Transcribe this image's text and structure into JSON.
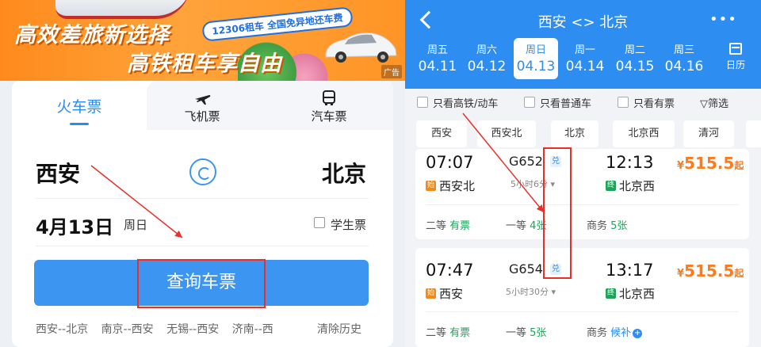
{
  "left": {
    "banner": {
      "tag": "12306租车 全国免异地还车费",
      "line1": "高效差旅新选择",
      "line2": "高铁租车享自由",
      "ad": "广告"
    },
    "tabs": [
      {
        "label": "火车票",
        "icon": "train-icon"
      },
      {
        "label": "飞机票",
        "icon": "plane-icon"
      },
      {
        "label": "汽车票",
        "icon": "bus-icon"
      }
    ],
    "from_city": "西安",
    "to_city": "北京",
    "date": "4月13日",
    "weekday": "周日",
    "student_ticket": "学生票",
    "search_button": "查询车票",
    "history": [
      "西安--北京",
      "南京--西安",
      "无锡--西安",
      "济南--西"
    ],
    "clear_history": "清除历史"
  },
  "right": {
    "title": "西安 <> 北京",
    "more": "•••",
    "days": [
      {
        "weekday": "周五",
        "date": "04.11"
      },
      {
        "weekday": "周六",
        "date": "04.12"
      },
      {
        "weekday": "周日",
        "date": "04.13",
        "selected": true
      },
      {
        "weekday": "周一",
        "date": "04.14"
      },
      {
        "weekday": "周二",
        "date": "04.15"
      },
      {
        "weekday": "周三",
        "date": "04.16"
      }
    ],
    "calendar": "日历",
    "filters": [
      "只看高铁/动车",
      "只看普通车",
      "只看有票",
      "筛选"
    ],
    "stations": [
      "西安",
      "西安北",
      "北京",
      "北京西",
      "清河"
    ],
    "trains": [
      {
        "depart": "07:07",
        "number": "G652",
        "dui": "兑",
        "arrive": "12:13",
        "price": "515.5",
        "yen": "¥",
        "qi": "起",
        "duration": "5小时6分",
        "from_badge": "始",
        "from": "西安北",
        "to_badge": "终",
        "to": "北京西",
        "seats": [
          {
            "class": "二等",
            "status": "有票"
          },
          {
            "class": "一等",
            "status": "4张"
          },
          {
            "class": "商务",
            "status": "5张"
          }
        ]
      },
      {
        "depart": "07:47",
        "number": "G654",
        "dui": "兑",
        "arrive": "13:17",
        "price": "515.5",
        "yen": "¥",
        "qi": "起",
        "duration": "5小时30分",
        "from_badge": "始",
        "from": "西安",
        "to_badge": "终",
        "to": "北京西",
        "seats": [
          {
            "class": "二等",
            "status": "有票"
          },
          {
            "class": "一等",
            "status": "5张"
          },
          {
            "class": "商务",
            "status": "候补"
          }
        ]
      }
    ]
  },
  "colors": {
    "primary": "#2d8df0",
    "price": "#ff7a1a",
    "available": "#1fa35a",
    "annotation": "#e8302a",
    "banner": "#ff8a1c"
  }
}
